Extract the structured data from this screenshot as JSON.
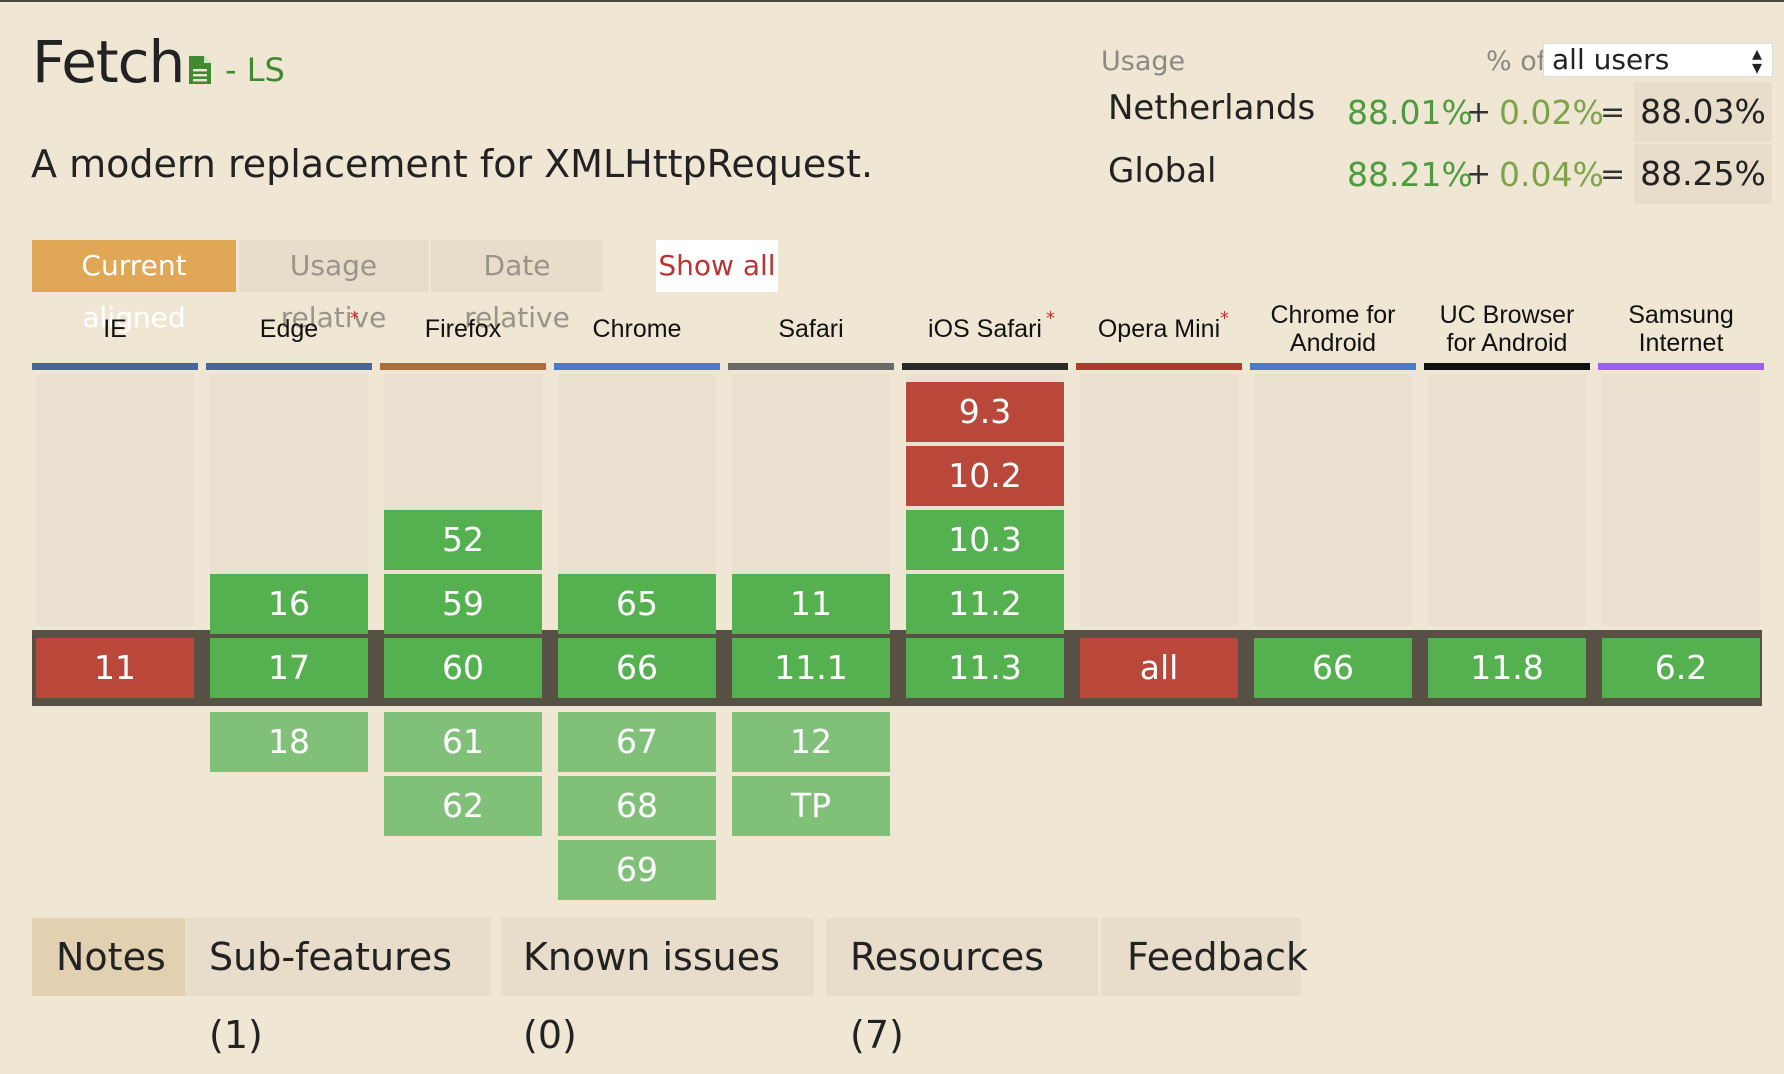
{
  "feature": {
    "title": "Fetch",
    "status": "- LS",
    "description": "A modern replacement for XMLHttpRequest."
  },
  "usage": {
    "label": "Usage",
    "pct_of_label": "% of",
    "filter_value": "all users",
    "rows": [
      {
        "region": "Netherlands",
        "supported": "88.01%",
        "partial": "0.02%",
        "total": "88.03%"
      },
      {
        "region": "Global",
        "supported": "88.21%",
        "partial": "0.04%",
        "total": "88.25%"
      }
    ],
    "plus": "+",
    "equals": "="
  },
  "view_tabs": {
    "current_aligned": "Current aligned",
    "usage_relative": "Usage relative",
    "date_relative": "Date relative",
    "show_all": "Show all"
  },
  "browsers": [
    {
      "name": "IE",
      "star": "",
      "color": "#4a6598",
      "past": [],
      "current": {
        "v": "11",
        "s": "red"
      },
      "future": []
    },
    {
      "name": "Edge",
      "star": "*",
      "color": "#4a6598",
      "past": [
        {
          "v": "16",
          "s": "green"
        }
      ],
      "current": {
        "v": "17",
        "s": "green"
      },
      "future": [
        "18"
      ]
    },
    {
      "name": "Firefox",
      "star": "",
      "color": "#b36a3c",
      "past": [
        {
          "v": "52",
          "s": "green"
        },
        {
          "v": "59",
          "s": "green"
        }
      ],
      "current": {
        "v": "60",
        "s": "green"
      },
      "future": [
        "61",
        "62"
      ]
    },
    {
      "name": "Chrome",
      "star": "",
      "color": "#4a7ac8",
      "past": [
        {
          "v": "65",
          "s": "green"
        }
      ],
      "current": {
        "v": "66",
        "s": "green"
      },
      "future": [
        "67",
        "68",
        "69"
      ]
    },
    {
      "name": "Safari",
      "star": "",
      "color": "#6a6a6a",
      "past": [
        {
          "v": "11",
          "s": "green"
        }
      ],
      "current": {
        "v": "11.1",
        "s": "green"
      },
      "future": [
        "12",
        "TP"
      ]
    },
    {
      "name": "iOS Safari",
      "star": "*",
      "color": "#2a2a2a",
      "past": [
        {
          "v": "9.3",
          "s": "red"
        },
        {
          "v": "10.2",
          "s": "red"
        },
        {
          "v": "10.3",
          "s": "green"
        },
        {
          "v": "11.2",
          "s": "green"
        }
      ],
      "current": {
        "v": "11.3",
        "s": "green"
      },
      "future": []
    },
    {
      "name": "Opera Mini",
      "star": "*",
      "color": "#b03a2e",
      "past": [],
      "current": {
        "v": "all",
        "s": "red"
      },
      "future": []
    },
    {
      "name": "Chrome for Android",
      "star": "",
      "color": "#4a7ac8",
      "past": [],
      "current": {
        "v": "66",
        "s": "green"
      },
      "future": []
    },
    {
      "name": "UC Browser for Android",
      "star": "",
      "color": "#111111",
      "past": [],
      "current": {
        "v": "11.8",
        "s": "green"
      },
      "future": []
    },
    {
      "name": "Samsung Internet",
      "star": "",
      "color": "#9a5ef0",
      "past": [],
      "current": {
        "v": "6.2",
        "s": "green"
      },
      "future": []
    }
  ],
  "bottom_tabs": [
    "Notes",
    "Sub-features (1)",
    "Known issues (0)",
    "Resources (7)",
    "Feedback"
  ]
}
